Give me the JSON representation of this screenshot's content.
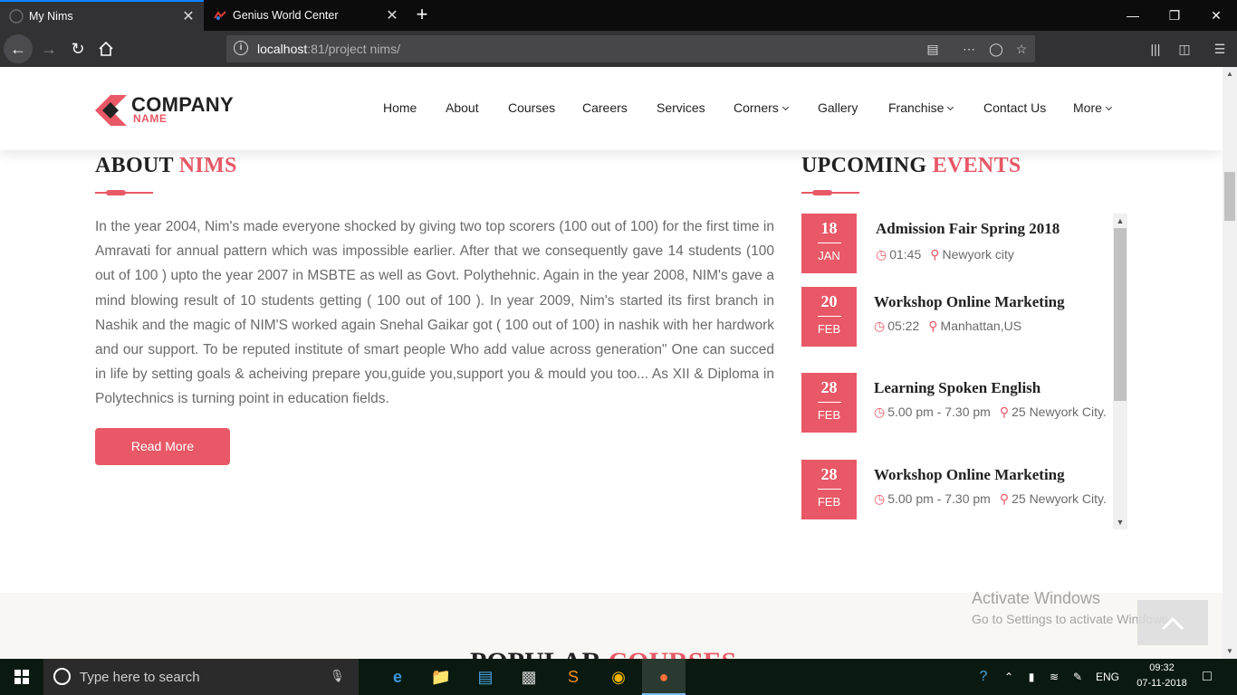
{
  "browser": {
    "tabs": [
      {
        "title": "My Nims",
        "active": true
      },
      {
        "title": "Genius World Center",
        "active": false
      }
    ],
    "url": {
      "host": "localhost",
      "port": ":81",
      "path": "/project nims/"
    }
  },
  "site": {
    "logo": {
      "line1": "COMPANY",
      "line2": "NAME"
    },
    "menu": [
      "Home",
      "About",
      "Courses",
      "Careers",
      "Services",
      "Corners",
      "Gallery",
      "Franchise",
      "Contact Us",
      "More"
    ],
    "about": {
      "title_main": "ABOUT ",
      "title_highlight": "NIMS",
      "text": "In the year 2004, Nim's made everyone shocked by giving two top scorers (100 out of 100) for the first time in Amravati for annual pattern which was impossible earlier. After that we consequently gave 14 students (100 out of 100 ) upto the year 2007 in MSBTE as well as Govt. Polythehnic. Again in the year 2008, NIM's gave a mind blowing result of 10 students getting ( 100 out of 100 ). In year 2009, Nim's started its first branch in Nashik and the magic of NIM'S worked again Snehal Gaikar got ( 100 out of 100) in nashik with her hardwork and our support. To be reputed institute of smart people Who add value across generation\" One can succed in life by setting goals & acheiving prepare you,guide you,support you & mould you too... As XII & Diploma in Polytechnics is turning point in education fields.",
      "button": "Read More"
    },
    "events": {
      "title_main": "UPCOMING ",
      "title_highlight": "EVENTS",
      "items": [
        {
          "day": "18",
          "month": "JAN",
          "title": "Admission Fair Spring 2018",
          "time": "01:45",
          "place": "Newyork city"
        },
        {
          "day": "20",
          "month": "FEB",
          "title": "Workshop Online Marketing",
          "time": "05:22",
          "place": "Manhattan,US"
        },
        {
          "day": "28",
          "month": "FEB",
          "title": "Learning Spoken English",
          "time": "5.00 pm - 7.30 pm",
          "place": "25 Newyork City."
        },
        {
          "day": "28",
          "month": "FEB",
          "title": "Workshop Online Marketing",
          "time": "5.00 pm - 7.30 pm",
          "place": "25 Newyork City."
        }
      ]
    },
    "popular": {
      "title_main": "POPULAR ",
      "title_highlight": "COURSES"
    }
  },
  "watermark": {
    "line1": "Activate Windows",
    "line2": "Go to Settings to activate Windows."
  },
  "taskbar": {
    "search_placeholder": "Type here to search",
    "language": "ENG",
    "time": "09:32",
    "date": "07-11-2018"
  },
  "colors": {
    "accent": "#e85866",
    "browser_dark": "#0c0c0d",
    "toolbar": "#323234"
  }
}
